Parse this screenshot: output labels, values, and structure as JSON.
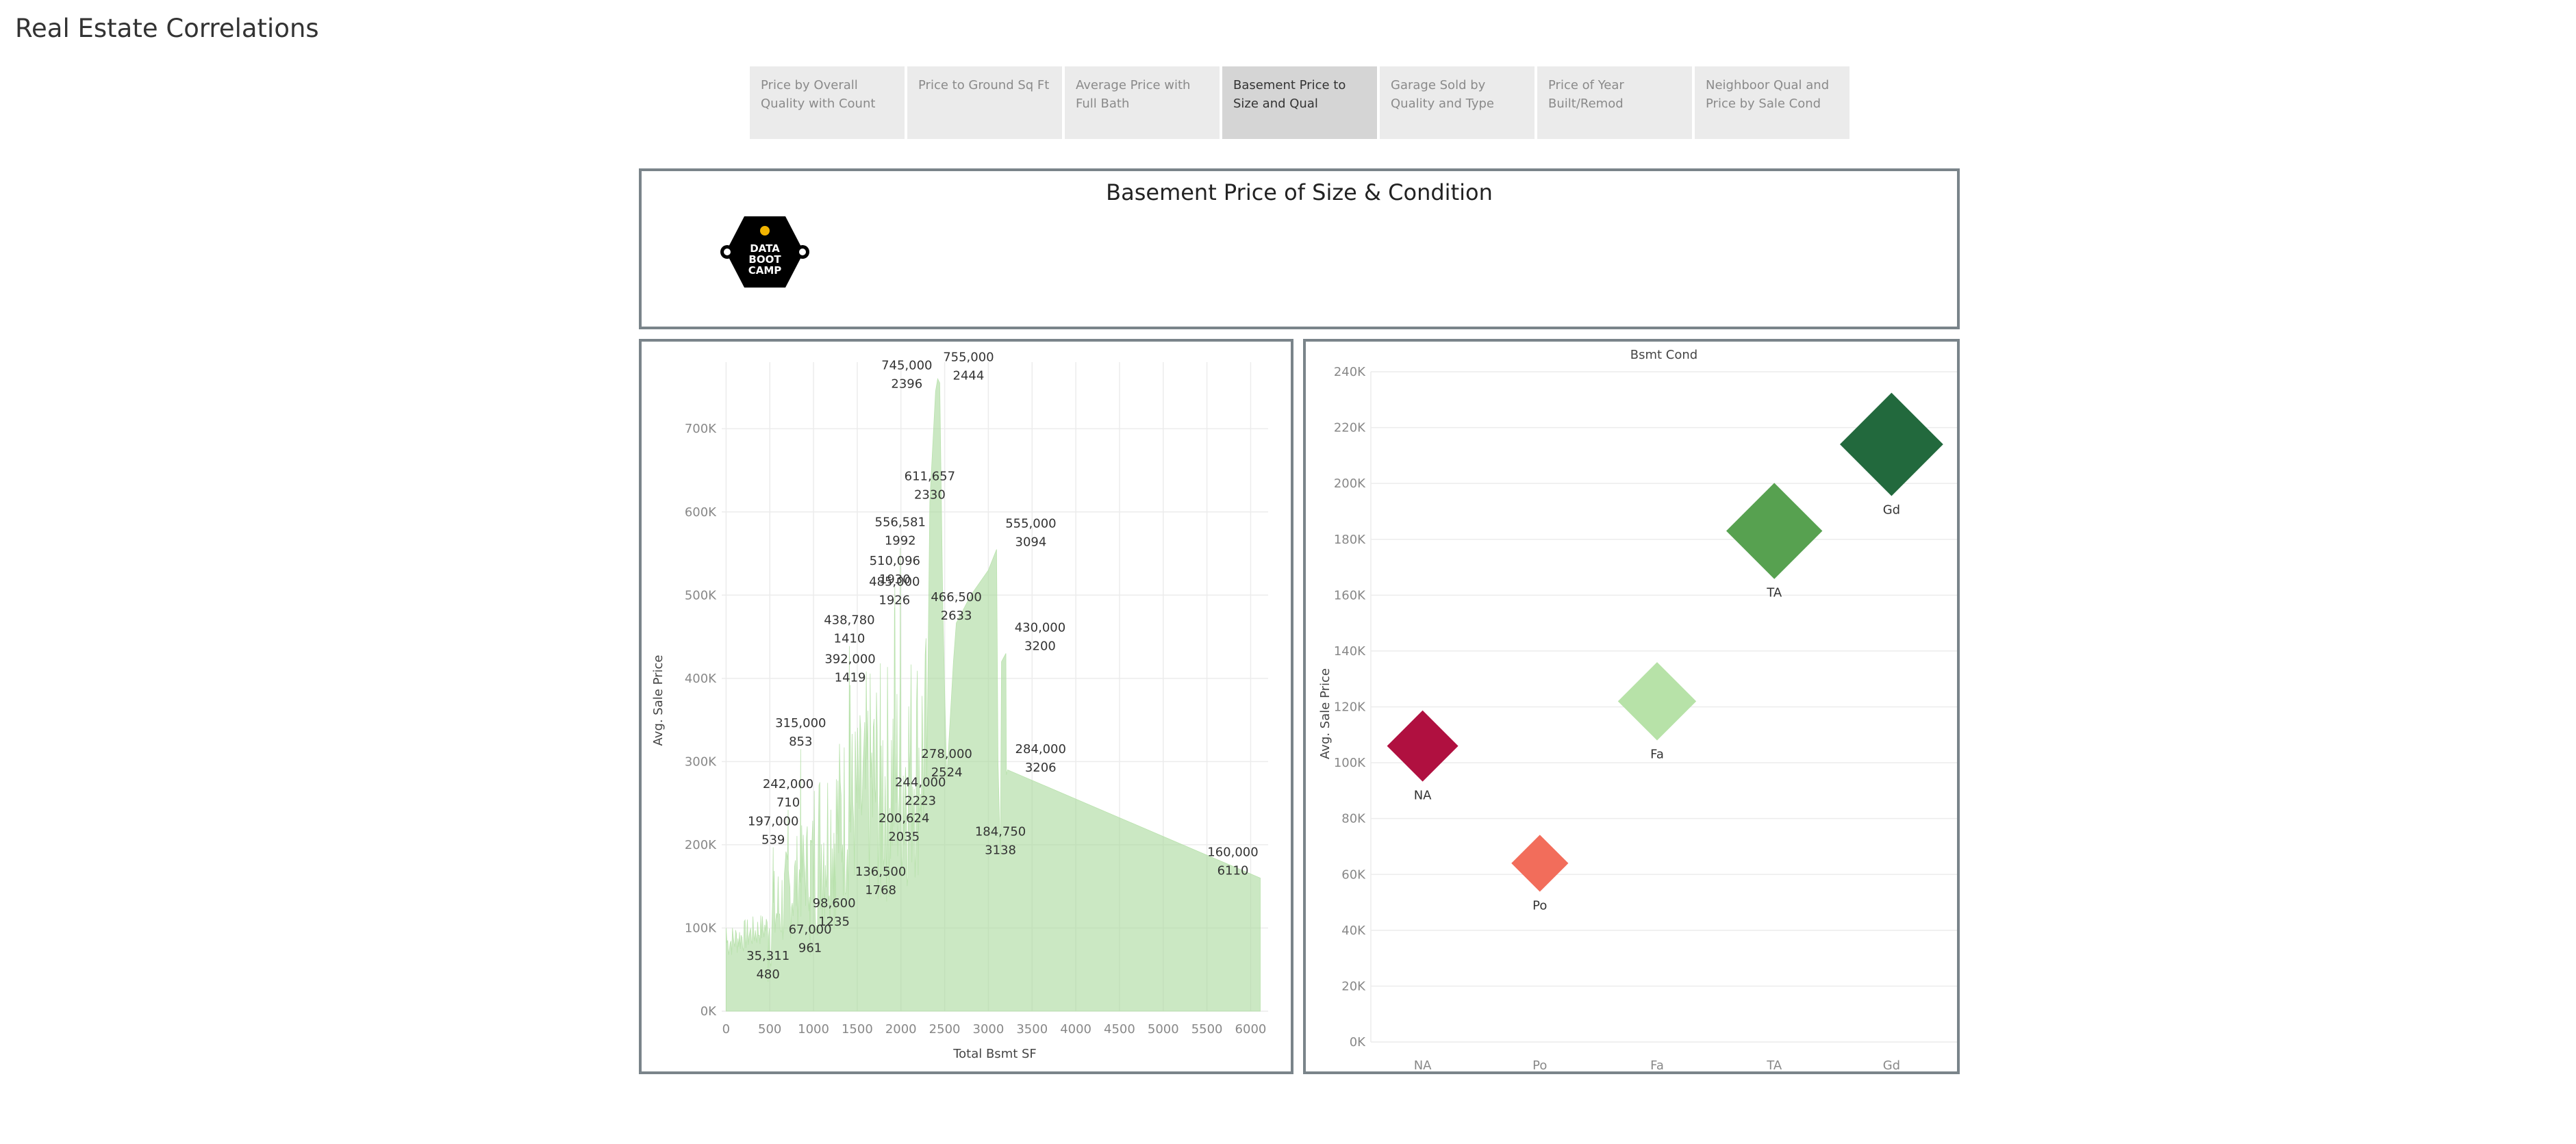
{
  "page_title": "Real Estate Correlations",
  "tabs": [
    {
      "label": "Price by Overall Quality with Count",
      "active": false
    },
    {
      "label": "Price to Ground Sq Ft",
      "active": false
    },
    {
      "label": "Average Price with Full Bath",
      "active": false
    },
    {
      "label": "Basement Price to Size and Qual",
      "active": true
    },
    {
      "label": "Garage Sold by Quality and Type",
      "active": false
    },
    {
      "label": "Price of Year Built/Remod",
      "active": false
    },
    {
      "label": "Neighboor Qual and Price by Sale Cond",
      "active": false
    }
  ],
  "dashboard": {
    "title": "Basement Price of Size & Condition",
    "logo": {
      "lines": [
        "DATA",
        "BOOT",
        "CAMP"
      ],
      "icon": "data-bootcamp-logo"
    }
  },
  "chart_data": [
    {
      "type": "area",
      "xlabel": "Total Bsmt SF",
      "ylabel": "Avg. Sale Price",
      "xlim": [
        -50,
        6200
      ],
      "ylim": [
        0,
        780000
      ],
      "x_ticks": [
        "0",
        "500",
        "1000",
        "1500",
        "2000",
        "2500",
        "3000",
        "3500",
        "4000",
        "4500",
        "5000",
        "5500",
        "6000"
      ],
      "y_ticks": [
        "0K",
        "100K",
        "200K",
        "300K",
        "400K",
        "500K",
        "600K",
        "700K"
      ],
      "fill_color": "#a9d99b",
      "grid": true,
      "labeled_points": [
        {
          "x": 480,
          "y": 35311,
          "value": "35,311",
          "sf": "480"
        },
        {
          "x": 539,
          "y": 197000,
          "value": "197,000",
          "sf": "539"
        },
        {
          "x": 710,
          "y": 242000,
          "value": "242,000",
          "sf": "710"
        },
        {
          "x": 853,
          "y": 315000,
          "value": "315,000",
          "sf": "853"
        },
        {
          "x": 961,
          "y": 67000,
          "value": "67,000",
          "sf": "961"
        },
        {
          "x": 1235,
          "y": 98600,
          "value": "98,600",
          "sf": "1235"
        },
        {
          "x": 1410,
          "y": 438780,
          "value": "438,780",
          "sf": "1410"
        },
        {
          "x": 1419,
          "y": 392000,
          "value": "392,000",
          "sf": "1419"
        },
        {
          "x": 1768,
          "y": 136500,
          "value": "136,500",
          "sf": "1768"
        },
        {
          "x": 1926,
          "y": 485000,
          "value": "485,000",
          "sf": "1926"
        },
        {
          "x": 1930,
          "y": 510096,
          "value": "510,096",
          "sf": "1930"
        },
        {
          "x": 1992,
          "y": 556581,
          "value": "556,581",
          "sf": "1992"
        },
        {
          "x": 2035,
          "y": 200624,
          "value": "200,624",
          "sf": "2035"
        },
        {
          "x": 2223,
          "y": 244000,
          "value": "244,000",
          "sf": "2223"
        },
        {
          "x": 2330,
          "y": 611657,
          "value": "611,657",
          "sf": "2330"
        },
        {
          "x": 2396,
          "y": 745000,
          "value": "745,000",
          "sf": "2396"
        },
        {
          "x": 2444,
          "y": 755000,
          "value": "755,000",
          "sf": "2444"
        },
        {
          "x": 2524,
          "y": 278000,
          "value": "278,000",
          "sf": "2524"
        },
        {
          "x": 2633,
          "y": 466500,
          "value": "466,500",
          "sf": "2633"
        },
        {
          "x": 3094,
          "y": 555000,
          "value": "555,000",
          "sf": "3094"
        },
        {
          "x": 3138,
          "y": 184750,
          "value": "184,750",
          "sf": "3138"
        },
        {
          "x": 3200,
          "y": 430000,
          "value": "430,000",
          "sf": "3200"
        },
        {
          "x": 3206,
          "y": 284000,
          "value": "284,000",
          "sf": "3206"
        },
        {
          "x": 6110,
          "y": 160000,
          "value": "160,000",
          "sf": "6110"
        }
      ]
    },
    {
      "type": "scatter",
      "title": "Bsmt Cond",
      "ylabel": "Avg. Sale Price",
      "categories": [
        "NA",
        "Po",
        "Fa",
        "TA",
        "Gd"
      ],
      "ylim": [
        0,
        240000
      ],
      "y_ticks": [
        "0K",
        "20K",
        "40K",
        "60K",
        "80K",
        "100K",
        "120K",
        "140K",
        "160K",
        "180K",
        "200K",
        "220K",
        "240K"
      ],
      "marker": "diamond",
      "grid": true,
      "points": [
        {
          "category": "NA",
          "y": 106000,
          "color": "#b01040",
          "size": 1.0
        },
        {
          "category": "Po",
          "y": 64000,
          "color": "#f26d5b",
          "size": 0.8
        },
        {
          "category": "Fa",
          "y": 122000,
          "color": "#b7e2a8",
          "size": 1.1
        },
        {
          "category": "TA",
          "y": 183000,
          "color": "#57a150",
          "size": 1.35
        },
        {
          "category": "Gd",
          "y": 214000,
          "color": "#22693d",
          "size": 1.45
        }
      ]
    }
  ]
}
